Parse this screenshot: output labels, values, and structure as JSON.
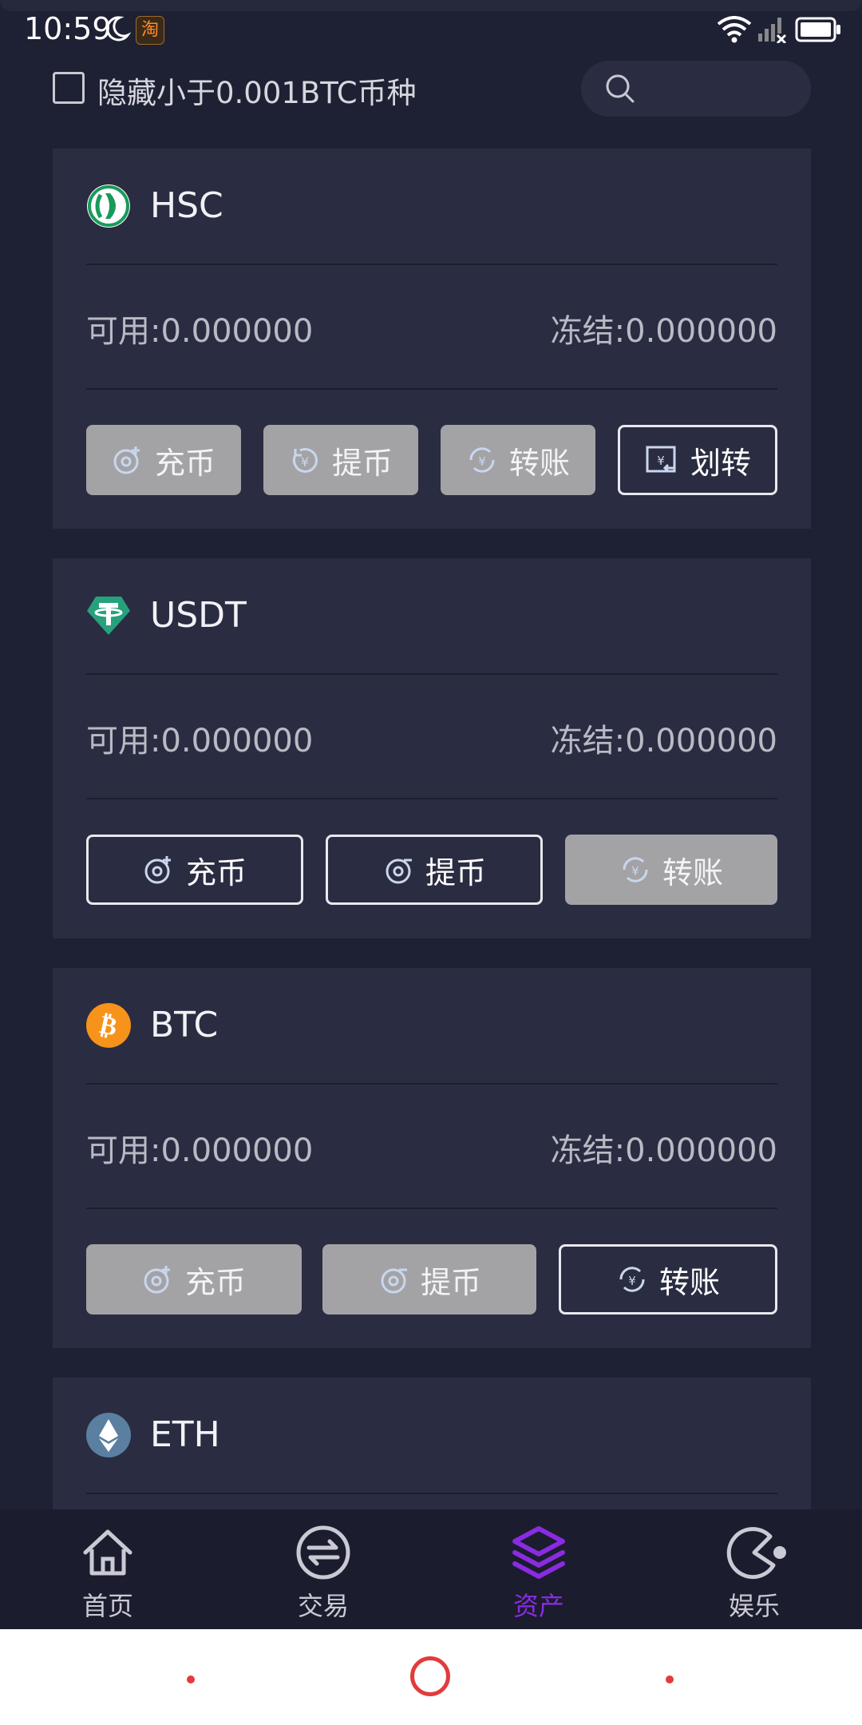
{
  "status_bar": {
    "time": "10:59",
    "app_badge": "淘"
  },
  "filter": {
    "hide_small_label": "隐藏小于0.001BTC币种",
    "search_placeholder": ""
  },
  "cards": [
    {
      "name": "HSC",
      "available": "可用:0.000000",
      "frozen": "冻结:0.000000",
      "icon": "hsc-coin-icon",
      "buttons": [
        {
          "label": "充币",
          "style": "filled",
          "icon": "deposit-icon"
        },
        {
          "label": "提币",
          "style": "filled",
          "icon": "withdraw-icon"
        },
        {
          "label": "转账",
          "style": "filled",
          "icon": "transfer-icon"
        },
        {
          "label": "划转",
          "style": "outline",
          "icon": "swap-icon"
        }
      ]
    },
    {
      "name": "USDT",
      "available": "可用:0.000000",
      "frozen": "冻结:0.000000",
      "icon": "usdt-coin-icon",
      "buttons": [
        {
          "label": "充币",
          "style": "outline",
          "icon": "deposit-icon"
        },
        {
          "label": "提币",
          "style": "outline",
          "icon": "withdraw-icon"
        },
        {
          "label": "转账",
          "style": "filled",
          "icon": "transfer-icon"
        }
      ]
    },
    {
      "name": "BTC",
      "available": "可用:0.000000",
      "frozen": "冻结:0.000000",
      "icon": "btc-coin-icon",
      "buttons": [
        {
          "label": "充币",
          "style": "filled",
          "icon": "deposit-icon"
        },
        {
          "label": "提币",
          "style": "filled",
          "icon": "withdraw-icon"
        },
        {
          "label": "转账",
          "style": "outline",
          "icon": "transfer-icon"
        }
      ]
    },
    {
      "name": "ETH",
      "icon": "eth-coin-icon"
    }
  ],
  "bottom_nav": [
    {
      "label": "首页",
      "icon": "home-icon"
    },
    {
      "label": "交易",
      "icon": "exchange-icon"
    },
    {
      "label": "资产",
      "icon": "layers-icon",
      "active": true
    },
    {
      "label": "娱乐",
      "icon": "pacman-icon"
    }
  ],
  "colors": {
    "background": "#1e2033",
    "card": "#2a2c41",
    "accent": "#8a2be2",
    "button_filled": "#a3a3a6"
  }
}
